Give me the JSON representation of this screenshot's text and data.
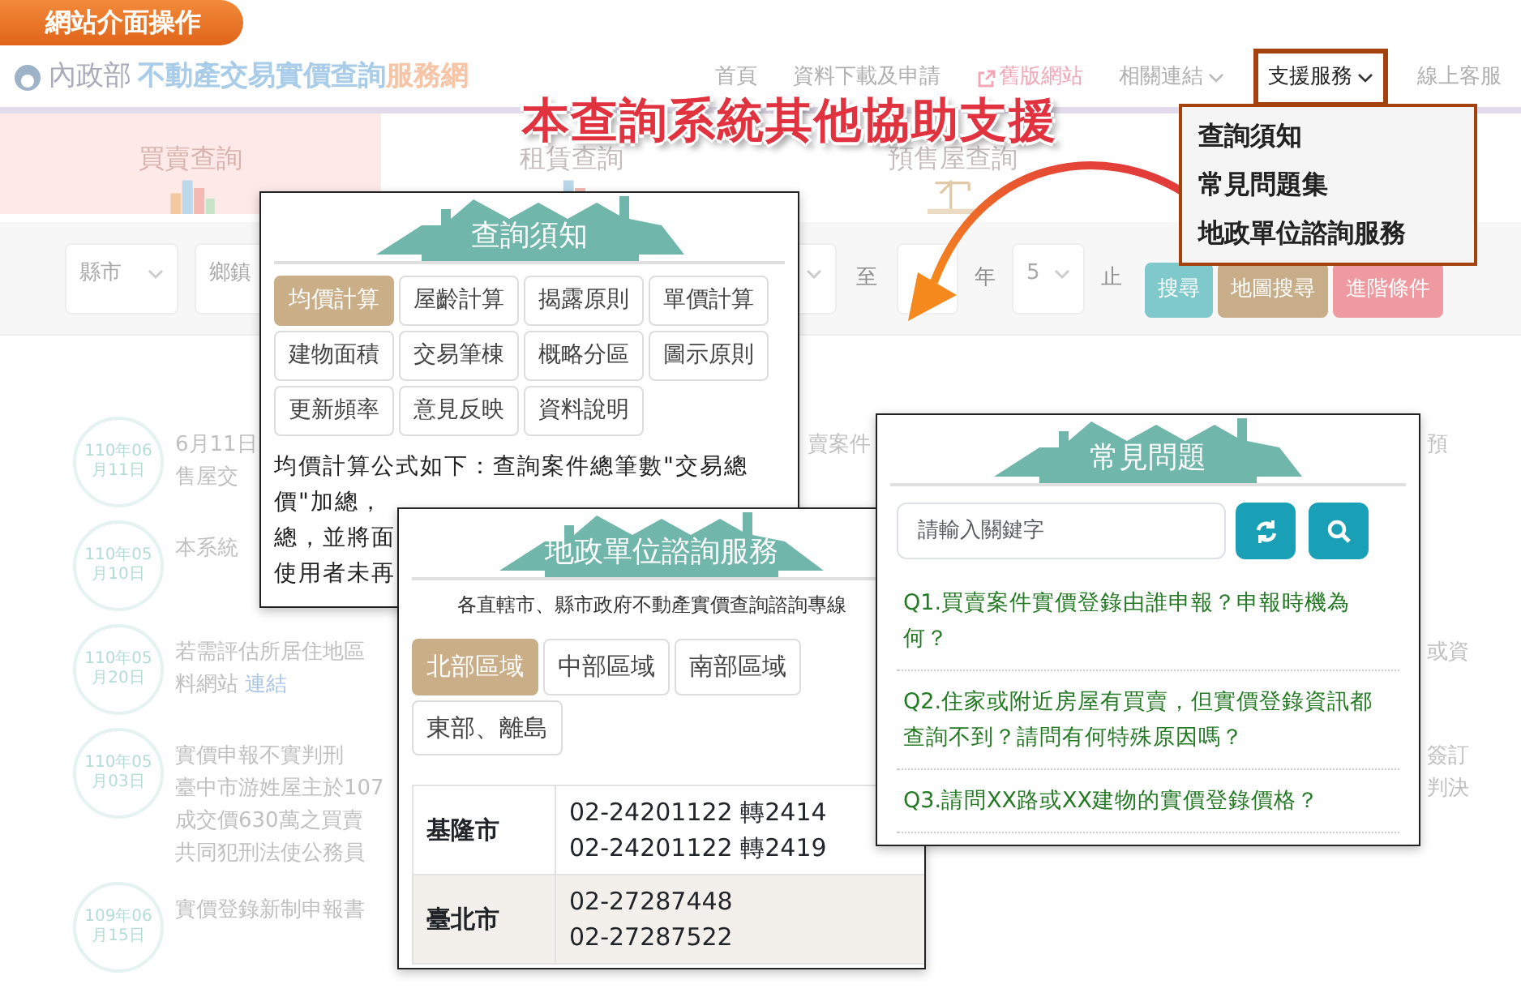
{
  "banner": {
    "label": "網站介面操作"
  },
  "site_header": {
    "logo_ministry": "內政部",
    "logo_title": "不動產交易實價查詢",
    "logo_suffix": "服務網",
    "nav": [
      {
        "label": "首頁",
        "kind": "link",
        "highlighted": false
      },
      {
        "label": "資料下載及申請",
        "kind": "link",
        "highlighted": false
      },
      {
        "label": "舊版網站",
        "kind": "external",
        "highlighted": false
      },
      {
        "label": "相關連結",
        "kind": "dropdown",
        "highlighted": false
      },
      {
        "label": "支援服務",
        "kind": "dropdown",
        "highlighted": true
      },
      {
        "label": "線上客服",
        "kind": "link",
        "highlighted": false
      }
    ]
  },
  "support_menu": {
    "items": [
      "查詢須知",
      "常見問題集",
      "地政單位諮詢服務"
    ]
  },
  "headline": "本查詢系統其他協助支援",
  "query_tabs": [
    {
      "label": "買賣查詢",
      "selected": true,
      "kind": "houses"
    },
    {
      "label": "租賃查詢",
      "selected": false,
      "kind": "houses"
    },
    {
      "label": "預售屋查詢",
      "selected": false,
      "kind": "crane"
    }
  ],
  "filters": {
    "county_placeholder": "縣市",
    "township_placeholder": "鄉鎮",
    "to_label": "至",
    "year_label": "年",
    "month_value": "5",
    "until_label": "止",
    "buttons": [
      {
        "label": "搜尋",
        "kind": "search"
      },
      {
        "label": "地圖搜尋",
        "kind": "map"
      },
      {
        "label": "進階條件",
        "kind": "advanced"
      }
    ]
  },
  "news": [
    {
      "date_top": "110年06",
      "date_bottom": "月11日",
      "lines": [
        "6月11日",
        "售屋交"
      ],
      "mid": "賣案件",
      "tail": [
        "預"
      ]
    },
    {
      "date_top": "110年05",
      "date_bottom": "月10日",
      "lines": [
        "本系統"
      ]
    },
    {
      "date_top": "110年05",
      "date_bottom": "月20日",
      "lines": [
        "若需評估所居住地區",
        "料網站"
      ],
      "link": "連結",
      "tail": [
        "或資"
      ]
    },
    {
      "date_top": "110年05",
      "date_bottom": "月03日",
      "lines": [
        "實價申報不實判刑",
        "臺中市游姓屋主於107",
        "成交價630萬之買賣",
        "共同犯刑法使公務員"
      ],
      "tail": [
        "簽訂",
        "判決"
      ]
    },
    {
      "date_top": "109年06",
      "date_bottom": "月15日",
      "lines": [
        "實價登錄新制申報書"
      ]
    }
  ],
  "notice_panel": {
    "title": "查詢須知",
    "topics": [
      {
        "label": "均價計算",
        "selected": true
      },
      {
        "label": "屋齡計算",
        "selected": false
      },
      {
        "label": "揭露原則",
        "selected": false
      },
      {
        "label": "單價計算",
        "selected": false
      },
      {
        "label": "建物面積",
        "selected": false
      },
      {
        "label": "交易筆棟",
        "selected": false
      },
      {
        "label": "概略分區",
        "selected": false
      },
      {
        "label": "圖示原則",
        "selected": false
      },
      {
        "label": "更新頻率",
        "selected": false
      },
      {
        "label": "意見反映",
        "selected": false
      },
      {
        "label": "資料說明",
        "selected": false
      }
    ],
    "text_lines": [
      "均價計算公式如下：查詢案件總筆數\"交易總",
      "價\"加總，",
      "總，並將面",
      "使用者未再"
    ]
  },
  "consult_panel": {
    "title": "地政單位諮詢服務",
    "subtitle": "各直轄市、縣市政府不動產實價查詢諮詢專線",
    "regions": [
      {
        "label": "北部區域",
        "selected": true
      },
      {
        "label": "中部區域",
        "selected": false
      },
      {
        "label": "南部區域",
        "selected": false
      },
      {
        "label": "東部、離島",
        "selected": false
      }
    ],
    "rows": [
      {
        "city": "基隆市",
        "phones": [
          "02-24201122 轉2414",
          "02-24201122 轉2419"
        ]
      },
      {
        "city": "臺北市",
        "phones": [
          "02-27287448",
          "02-27287522"
        ]
      }
    ]
  },
  "faq_panel": {
    "title": "常見問題",
    "search": {
      "placeholder": "請輸入關鍵字"
    },
    "questions": [
      "Q1.買賣案件實價登錄由誰申報？申報時機為何？",
      "Q2.住家或附近房屋有買賣，但實價登錄資訊都查詢不到？請問有何特殊原因嗎？",
      "Q3.請問XX路或XX建物的實價登錄價格？"
    ]
  }
}
